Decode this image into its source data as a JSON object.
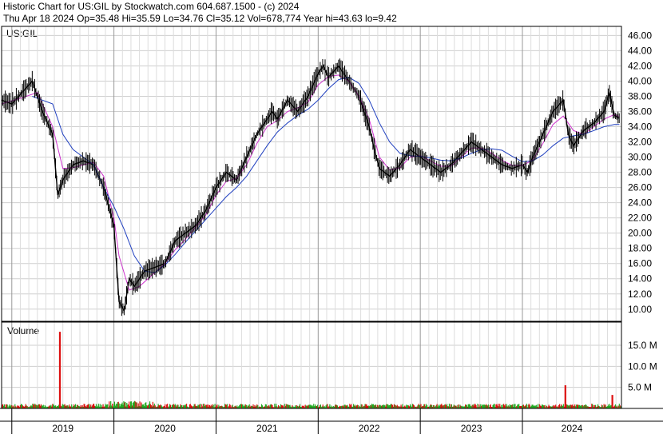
{
  "header": {
    "line1": "Historic Chart for US:GIL by Stockwatch.com 604.687.1500 - (c) 2024",
    "line2": "Thu Apr 18 2024   Op=35.48  Hi=35.59  Lo=34.76  Cl=35.12  Vol=678,774  Year hi=43.63  lo=9.42"
  },
  "chart_data": [
    {
      "type": "line",
      "symbol_label": "US:GIL",
      "y_ticks": [
        "46.00",
        "44.00",
        "42.00",
        "40.00",
        "38.00",
        "36.00",
        "34.00",
        "32.00",
        "30.00",
        "28.00",
        "26.00",
        "24.00",
        "22.00",
        "20.00",
        "18.00",
        "16.00",
        "14.00",
        "12.00",
        "10.00"
      ],
      "ylim": [
        8.4,
        47.2
      ],
      "x_ticks": [
        "2019",
        "2020",
        "2021",
        "2022",
        "2023",
        "2024"
      ],
      "price_color": "#000000",
      "series": [
        {
          "color": "#000000",
          "values": [
            [
              2018.9,
              37.5
            ],
            [
              2019.0,
              37
            ],
            [
              2019.1,
              38.5
            ],
            [
              2019.2,
              40
            ],
            [
              2019.25,
              38
            ],
            [
              2019.3,
              36
            ],
            [
              2019.4,
              33
            ],
            [
              2019.45,
              25
            ],
            [
              2019.5,
              27
            ],
            [
              2019.6,
              29
            ],
            [
              2019.7,
              29.5
            ],
            [
              2019.8,
              29
            ],
            [
              2019.9,
              26
            ],
            [
              2020.0,
              21
            ],
            [
              2020.05,
              11
            ],
            [
              2020.1,
              9.8
            ],
            [
              2020.15,
              14
            ],
            [
              2020.2,
              13
            ],
            [
              2020.3,
              15
            ],
            [
              2020.4,
              15.5
            ],
            [
              2020.5,
              16
            ],
            [
              2020.6,
              19
            ],
            [
              2020.7,
              20
            ],
            [
              2020.8,
              21
            ],
            [
              2020.9,
              23
            ],
            [
              2021.0,
              26
            ],
            [
              2021.1,
              28
            ],
            [
              2021.2,
              27
            ],
            [
              2021.3,
              30
            ],
            [
              2021.4,
              33
            ],
            [
              2021.5,
              35
            ],
            [
              2021.55,
              36
            ],
            [
              2021.6,
              35
            ],
            [
              2021.7,
              37.5
            ],
            [
              2021.8,
              36
            ],
            [
              2021.9,
              38
            ],
            [
              2022.0,
              41
            ],
            [
              2022.05,
              42
            ],
            [
              2022.1,
              40.5
            ],
            [
              2022.2,
              42
            ],
            [
              2022.3,
              40
            ],
            [
              2022.4,
              38
            ],
            [
              2022.5,
              34
            ],
            [
              2022.55,
              31
            ],
            [
              2022.6,
              28.5
            ],
            [
              2022.7,
              27.5
            ],
            [
              2022.8,
              29
            ],
            [
              2022.9,
              31
            ],
            [
              2023.0,
              30
            ],
            [
              2023.1,
              29
            ],
            [
              2023.2,
              28
            ],
            [
              2023.3,
              29
            ],
            [
              2023.4,
              30.5
            ],
            [
              2023.5,
              32
            ],
            [
              2023.6,
              31
            ],
            [
              2023.7,
              30
            ],
            [
              2023.8,
              29
            ],
            [
              2023.9,
              28.5
            ],
            [
              2024.0,
              29
            ],
            [
              2024.05,
              28
            ],
            [
              2024.1,
              30
            ],
            [
              2024.2,
              33
            ],
            [
              2024.3,
              36
            ],
            [
              2024.4,
              37.5
            ],
            [
              2024.45,
              33
            ],
            [
              2024.5,
              31.5
            ],
            [
              2024.6,
              33.5
            ],
            [
              2024.7,
              34.5
            ],
            [
              2024.8,
              36
            ],
            [
              2024.85,
              38.5
            ],
            [
              2024.9,
              35.5
            ],
            [
              2024.95,
              35.1
            ]
          ]
        },
        {
          "color": "#cc33cc",
          "values": [
            [
              2018.9,
              37
            ],
            [
              2019.1,
              37.8
            ],
            [
              2019.25,
              38.5
            ],
            [
              2019.4,
              34
            ],
            [
              2019.5,
              28.5
            ],
            [
              2019.6,
              28.6
            ],
            [
              2019.7,
              29
            ],
            [
              2019.8,
              29.3
            ],
            [
              2019.9,
              27.5
            ],
            [
              2020.0,
              22
            ],
            [
              2020.05,
              17
            ],
            [
              2020.15,
              12.5
            ],
            [
              2020.25,
              13
            ],
            [
              2020.4,
              14.8
            ],
            [
              2020.5,
              16
            ],
            [
              2020.6,
              17.8
            ],
            [
              2020.7,
              19.2
            ],
            [
              2020.8,
              20.8
            ],
            [
              2020.9,
              22.4
            ],
            [
              2021.0,
              25
            ],
            [
              2021.1,
              26.8
            ],
            [
              2021.2,
              27.2
            ],
            [
              2021.3,
              29
            ],
            [
              2021.4,
              31.8
            ],
            [
              2021.5,
              34
            ],
            [
              2021.6,
              34.8
            ],
            [
              2021.7,
              36
            ],
            [
              2021.8,
              36.5
            ],
            [
              2021.9,
              37.2
            ],
            [
              2022.0,
              39.5
            ],
            [
              2022.1,
              40.6
            ],
            [
              2022.2,
              40.8
            ],
            [
              2022.3,
              40
            ],
            [
              2022.4,
              38
            ],
            [
              2022.5,
              35
            ],
            [
              2022.6,
              30
            ],
            [
              2022.7,
              28.3
            ],
            [
              2022.8,
              28.6
            ],
            [
              2022.9,
              30
            ],
            [
              2023.0,
              30.2
            ],
            [
              2023.1,
              29.5
            ],
            [
              2023.2,
              28.8
            ],
            [
              2023.3,
              28.8
            ],
            [
              2023.4,
              30
            ],
            [
              2023.5,
              31.2
            ],
            [
              2023.6,
              31.2
            ],
            [
              2023.7,
              30.5
            ],
            [
              2023.8,
              29.6
            ],
            [
              2023.9,
              28.9
            ],
            [
              2024.0,
              28.9
            ],
            [
              2024.1,
              29.6
            ],
            [
              2024.2,
              31.8
            ],
            [
              2024.3,
              34.3
            ],
            [
              2024.4,
              35.4
            ],
            [
              2024.5,
              33.5
            ],
            [
              2024.6,
              33
            ],
            [
              2024.7,
              34
            ],
            [
              2024.8,
              35
            ],
            [
              2024.9,
              35.6
            ],
            [
              2024.95,
              35.3
            ]
          ]
        },
        {
          "color": "#1f3fbf",
          "values": [
            [
              2019.2,
              38
            ],
            [
              2019.3,
              37.5
            ],
            [
              2019.4,
              37
            ],
            [
              2019.5,
              33
            ],
            [
              2019.6,
              31
            ],
            [
              2019.7,
              30
            ],
            [
              2019.8,
              29
            ],
            [
              2019.9,
              26
            ],
            [
              2020.0,
              23.5
            ],
            [
              2020.1,
              20.5
            ],
            [
              2020.2,
              17
            ],
            [
              2020.3,
              15
            ],
            [
              2020.4,
              14.8
            ],
            [
              2020.5,
              15.8
            ],
            [
              2020.6,
              17.2
            ],
            [
              2020.7,
              18.8
            ],
            [
              2020.8,
              20.3
            ],
            [
              2020.9,
              21.8
            ],
            [
              2021.0,
              23.3
            ],
            [
              2021.1,
              24.8
            ],
            [
              2021.2,
              26
            ],
            [
              2021.3,
              27.5
            ],
            [
              2021.4,
              29.5
            ],
            [
              2021.5,
              31.5
            ],
            [
              2021.6,
              33.3
            ],
            [
              2021.7,
              34.5
            ],
            [
              2021.8,
              35.5
            ],
            [
              2021.9,
              36.3
            ],
            [
              2022.0,
              37.5
            ],
            [
              2022.1,
              39
            ],
            [
              2022.2,
              40.2
            ],
            [
              2022.3,
              40.5
            ],
            [
              2022.4,
              39.7
            ],
            [
              2022.5,
              37.5
            ],
            [
              2022.6,
              34.5
            ],
            [
              2022.7,
              32
            ],
            [
              2022.8,
              30.5
            ],
            [
              2022.9,
              30.2
            ],
            [
              2023.0,
              30.1
            ],
            [
              2023.1,
              29.9
            ],
            [
              2023.2,
              29.6
            ],
            [
              2023.3,
              29.5
            ],
            [
              2023.4,
              29.9
            ],
            [
              2023.5,
              30.5
            ],
            [
              2023.6,
              31
            ],
            [
              2023.7,
              31.1
            ],
            [
              2023.8,
              30.9
            ],
            [
              2023.9,
              30.1
            ],
            [
              2024.0,
              29.4
            ],
            [
              2024.1,
              29.5
            ],
            [
              2024.2,
              30.3
            ],
            [
              2024.3,
              31.5
            ],
            [
              2024.4,
              32.5
            ],
            [
              2024.5,
              32.8
            ],
            [
              2024.6,
              33
            ],
            [
              2024.7,
              33.5
            ],
            [
              2024.8,
              34
            ],
            [
              2024.9,
              34.3
            ],
            [
              2024.95,
              34.3
            ]
          ]
        }
      ]
    },
    {
      "type": "bar",
      "title": "Volume",
      "y_ticks": [
        "15.0 M",
        "10.0 M",
        "5.0 M"
      ],
      "ylim": [
        0,
        20.5
      ],
      "up_color": "#22aa22",
      "down_color": "#dd1111",
      "spikes": [
        [
          2019.47,
          18.2
        ],
        [
          2024.42,
          5.5
        ],
        [
          2024.88,
          3.2
        ]
      ],
      "baseline_millions": 0.7
    }
  ]
}
